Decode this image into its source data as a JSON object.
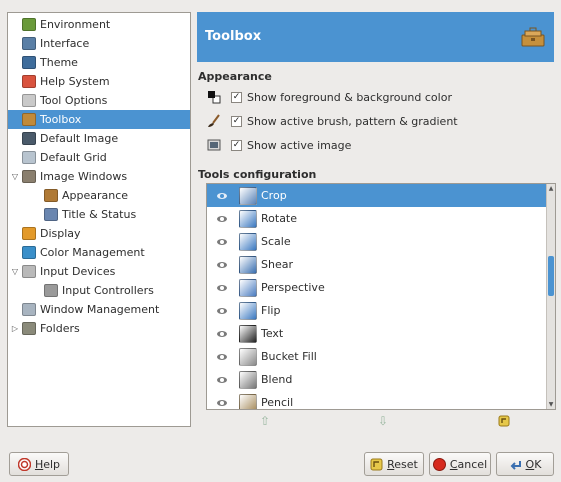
{
  "tree": {
    "items": [
      {
        "label": "Environment",
        "icon": "environment-icon",
        "color": "#6a9a3a",
        "level": 0
      },
      {
        "label": "Interface",
        "icon": "interface-icon",
        "color": "#5a7fa6",
        "level": 0
      },
      {
        "label": "Theme",
        "icon": "theme-icon",
        "color": "#3f6d9c",
        "level": 0
      },
      {
        "label": "Help System",
        "icon": "help-system-icon",
        "color": "#d9533e",
        "level": 0
      },
      {
        "label": "Tool Options",
        "icon": "tool-options-icon",
        "color": "#c9c9c9",
        "level": 0
      },
      {
        "label": "Toolbox",
        "icon": "toolbox-icon",
        "color": "#c08a3a",
        "level": 0,
        "selected": true
      },
      {
        "label": "Default Image",
        "icon": "default-image-icon",
        "color": "#4a5a6a",
        "level": 0
      },
      {
        "label": "Default Grid",
        "icon": "default-grid-icon",
        "color": "#b8c4cf",
        "level": 0
      },
      {
        "label": "Image Windows",
        "icon": "image-windows-icon",
        "color": "#8a7f6e",
        "level": 0,
        "expanded": true
      },
      {
        "label": "Appearance",
        "icon": "appearance-icon",
        "color": "#b07a36",
        "level": 1
      },
      {
        "label": "Title & Status",
        "icon": "title-status-icon",
        "color": "#6a86b0",
        "level": 1
      },
      {
        "label": "Display",
        "icon": "display-icon",
        "color": "#e39a2a",
        "level": 0
      },
      {
        "label": "Color Management",
        "icon": "color-management-icon",
        "color": "#3a8fc9",
        "level": 0
      },
      {
        "label": "Input Devices",
        "icon": "input-devices-icon",
        "color": "#b9b9b9",
        "level": 0,
        "expanded": true
      },
      {
        "label": "Input Controllers",
        "icon": "input-controllers-icon",
        "color": "#9a9a9a",
        "level": 1
      },
      {
        "label": "Window Management",
        "icon": "window-management-icon",
        "color": "#a8b4c0",
        "level": 0
      },
      {
        "label": "Folders",
        "icon": "folders-icon",
        "color": "#8a8a7a",
        "level": 0,
        "collapsed": true
      }
    ]
  },
  "banner": {
    "title": "Toolbox"
  },
  "appearance": {
    "heading": "Appearance",
    "options": [
      {
        "label": "Show foreground & background color",
        "checked": true,
        "icon": "fg-bg-color-icon"
      },
      {
        "label": "Show active brush, pattern & gradient",
        "checked": true,
        "icon": "brush-icon"
      },
      {
        "label": "Show active image",
        "checked": true,
        "icon": "active-image-icon"
      }
    ]
  },
  "tools": {
    "heading": "Tools configuration",
    "items": [
      {
        "label": "Crop",
        "icon": "crop-icon",
        "color": "#5a84b8",
        "selected": true
      },
      {
        "label": "Rotate",
        "icon": "rotate-icon",
        "color": "#3a78c0"
      },
      {
        "label": "Scale",
        "icon": "scale-icon",
        "color": "#3a78c0"
      },
      {
        "label": "Shear",
        "icon": "shear-icon",
        "color": "#3a6fb0"
      },
      {
        "label": "Perspective",
        "icon": "perspective-icon",
        "color": "#4a7cc0"
      },
      {
        "label": "Flip",
        "icon": "flip-icon",
        "color": "#3a78c0"
      },
      {
        "label": "Text",
        "icon": "text-tool-icon",
        "color": "#222222"
      },
      {
        "label": "Bucket Fill",
        "icon": "bucket-fill-icon",
        "color": "#8a8a8a"
      },
      {
        "label": "Blend",
        "icon": "blend-icon",
        "color": "#777777"
      },
      {
        "label": "Pencil",
        "icon": "pencil-icon",
        "color": "#a58a5a"
      }
    ]
  },
  "buttons": {
    "help": {
      "label": "Help",
      "mnemonic": "H"
    },
    "reset": {
      "label": "Reset",
      "mnemonic": "R"
    },
    "cancel": {
      "label": "Cancel",
      "mnemonic": "C"
    },
    "ok": {
      "label": "OK",
      "mnemonic": "O"
    }
  },
  "colors": {
    "selection": "#4b93d1",
    "window_bg": "#edebe9"
  }
}
